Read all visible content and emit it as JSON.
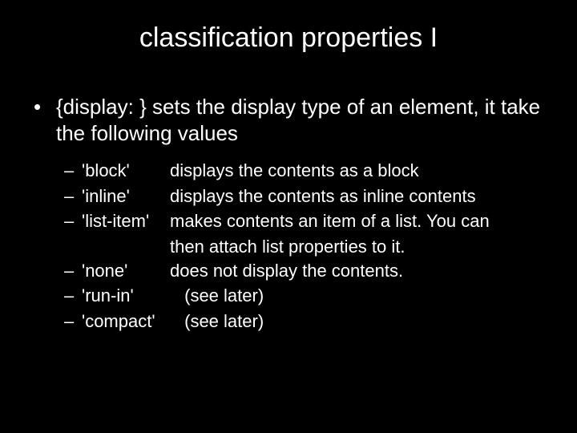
{
  "title": "classification properties I",
  "bullet_main": "{display: } sets the display type of an element, it take the following values",
  "items": [
    {
      "term": "'block'",
      "desc": "displays the contents as a block"
    },
    {
      "term": "'inline'",
      "desc": "displays the contents as inline contents"
    },
    {
      "term": "'list-item'",
      "desc": "makes contents an item of a list. You can",
      "cont": "then attach list properties to it."
    },
    {
      "term": "'none'",
      "desc": "does not display the contents."
    },
    {
      "term": "'run-in'",
      "desc": " (see later)"
    },
    {
      "term": "'compact'",
      "desc": " (see later)"
    }
  ]
}
